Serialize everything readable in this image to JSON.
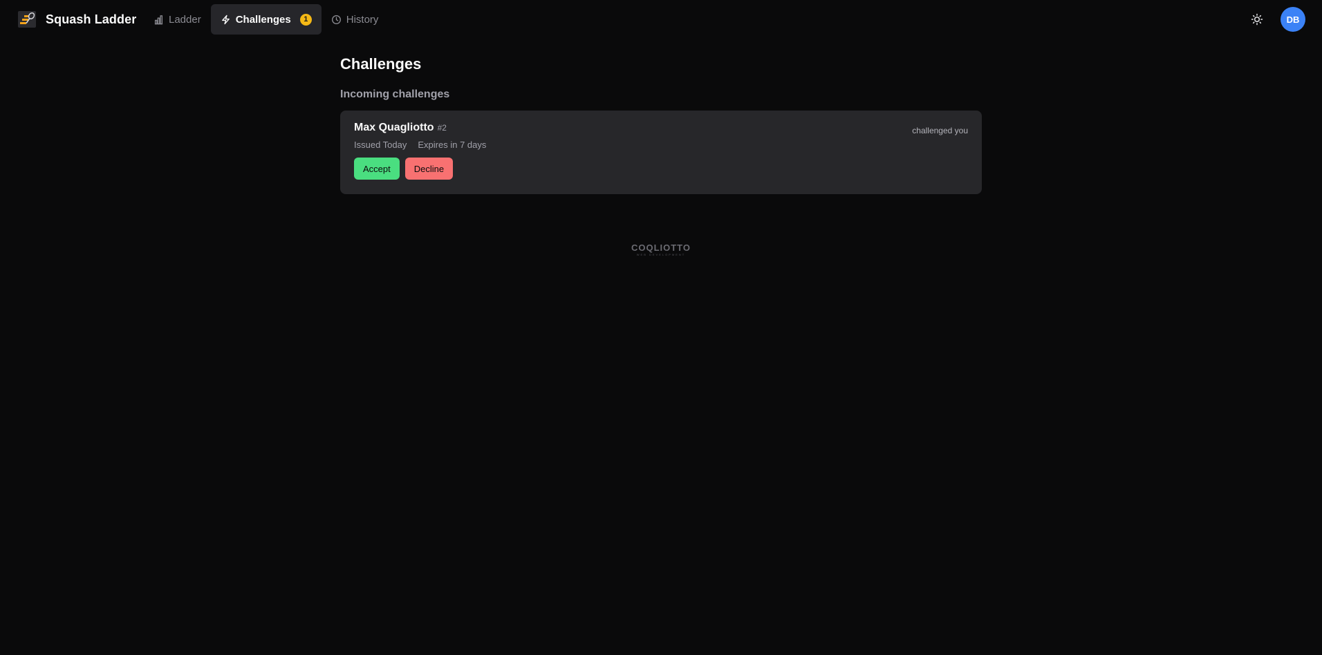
{
  "brand": {
    "name": "Squash Ladder",
    "logo_icon": "racket-ladder-logo"
  },
  "nav": {
    "ladder": {
      "label": "Ladder",
      "icon": "bar-chart-icon"
    },
    "challenges": {
      "label": "Challenges",
      "icon": "lightning-icon",
      "badge": "1",
      "active": true
    },
    "history": {
      "label": "History",
      "icon": "clock-icon"
    }
  },
  "header": {
    "theme_icon": "sun-icon",
    "avatar_initials": "DB"
  },
  "page": {
    "title": "Challenges",
    "incoming_title": "Incoming challenges"
  },
  "incoming_challenges": [
    {
      "player": "Max Quagliotto",
      "rank": "#2",
      "status": "challenged you",
      "issued": "Issued Today",
      "expires": "Expires in 7 days",
      "accept_label": "Accept",
      "decline_label": "Decline"
    }
  ],
  "footer": {
    "wordmark": "COQLIOTTO",
    "tagline": "WEB DEVELOPMENT"
  },
  "colors": {
    "background": "#0a0a0b",
    "card": "#27272a",
    "accent_badge": "#f5b815",
    "avatar": "#3b82f6",
    "accept": "#4ade80",
    "decline": "#f87171"
  }
}
